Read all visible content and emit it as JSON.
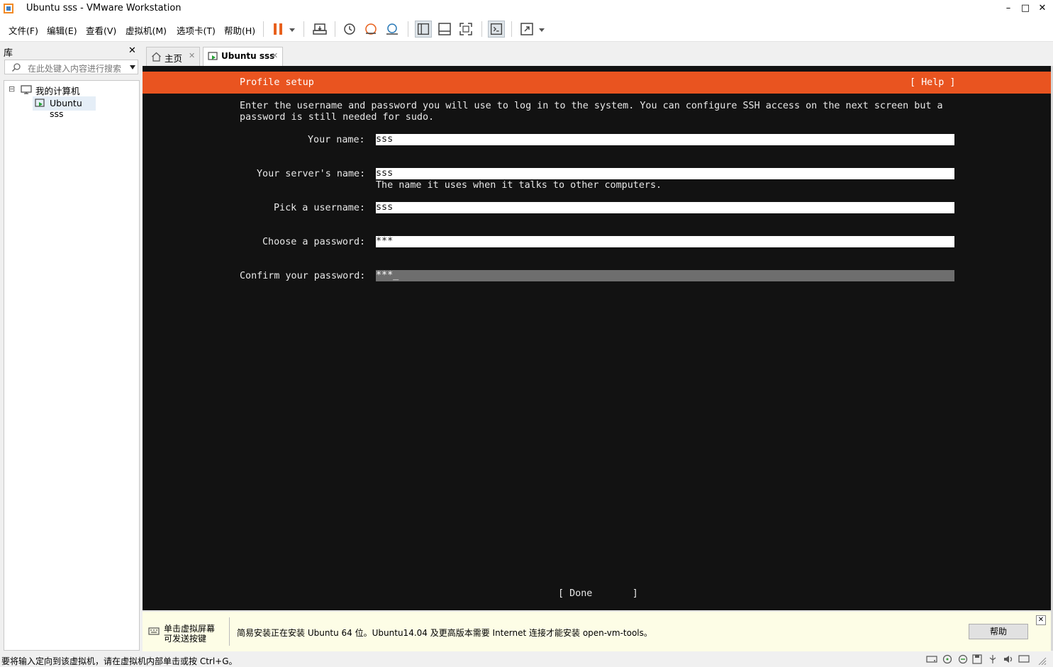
{
  "window": {
    "title": "Ubuntu sss - VMware Workstation",
    "controls": {
      "minimize": "–",
      "maximize": "□",
      "close": "✕"
    }
  },
  "menu": [
    "文件(F)",
    "编辑(E)",
    "查看(V)",
    "虚拟机(M)",
    "选项卡(T)",
    "帮助(H)"
  ],
  "library": {
    "title": "库",
    "close": "✕",
    "search_placeholder": "在此处键入内容进行搜索",
    "tree": {
      "expander": "⊟",
      "root": "我的计算机",
      "child": "Ubuntu sss"
    }
  },
  "tabs": [
    {
      "label": "主页",
      "close": "✕"
    },
    {
      "label": "Ubuntu sss",
      "close": "✕"
    }
  ],
  "terminal": {
    "header_title": "Profile setup",
    "help": "[ Help ]",
    "intro_line1": "Enter the username and password you will use to log in to the system. You can configure SSH access on the next screen but a",
    "intro_line2": "password is still needed for sudo.",
    "fields": [
      {
        "label": "Your name:",
        "value": "sss"
      },
      {
        "label": "Your server's name:",
        "value": "sss",
        "hint": "The name it uses when it talks to other computers."
      },
      {
        "label": "Pick a username:",
        "value": "sss"
      },
      {
        "label": "Choose a password:",
        "value": "***"
      },
      {
        "label": "Confirm your password:",
        "value": "***_"
      }
    ],
    "done_button": "[ Done       ]"
  },
  "infobar": {
    "click_hint_line1": "单击虚拟屏幕",
    "click_hint_line2": "可发送按键",
    "message": "简易安装正在安装 Ubuntu 64 位。Ubuntu14.04 及更高版本需要 Internet 连接才能安装 open-vm-tools。",
    "help_button": "帮助",
    "close": "✕"
  },
  "statusbar": {
    "message": "要将输入定向到该虚拟机，请在虚拟机内部单击或按 Ctrl+G。"
  },
  "colors": {
    "accent": "#e95420",
    "terminal_bg": "#121212",
    "pause": "#e8601c"
  }
}
